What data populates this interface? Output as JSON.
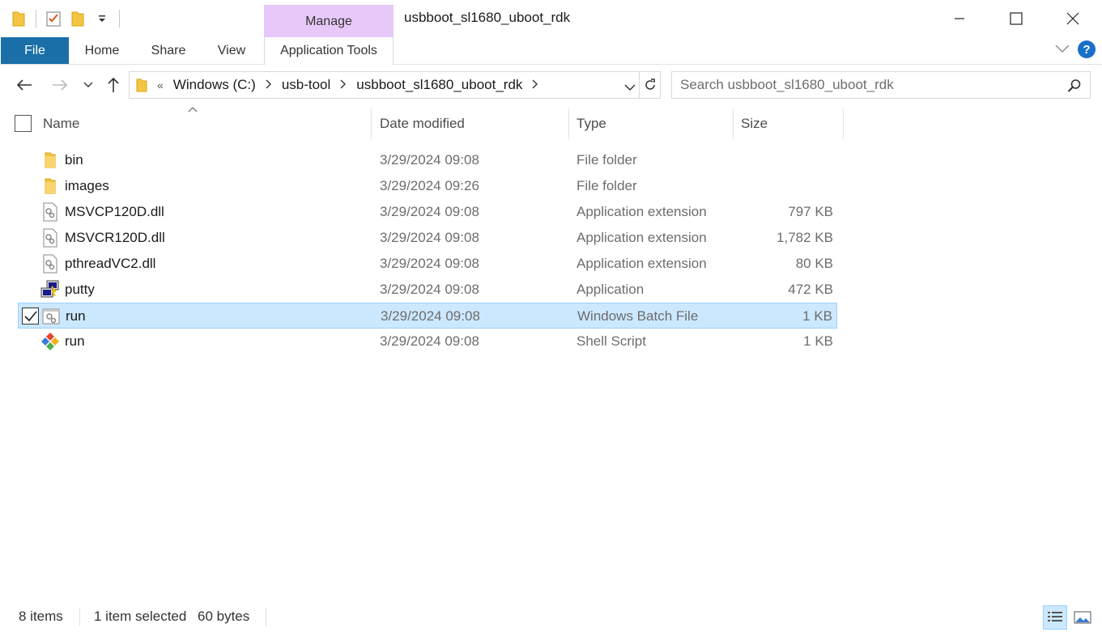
{
  "window": {
    "title": "usbboot_sl1680_uboot_rdk",
    "contextual_group": "Manage"
  },
  "ribbon": {
    "tabs": [
      {
        "label": "File"
      },
      {
        "label": "Home"
      },
      {
        "label": "Share"
      },
      {
        "label": "View"
      },
      {
        "label": "Application Tools"
      }
    ],
    "help_label": "?"
  },
  "address": {
    "overflow": "«",
    "crumbs": [
      "Windows (C:)",
      "usb-tool",
      "usbboot_sl1680_uboot_rdk"
    ]
  },
  "search": {
    "placeholder": "Search usbboot_sl1680_uboot_rdk"
  },
  "columns": {
    "name": "Name",
    "date": "Date modified",
    "type": "Type",
    "size": "Size"
  },
  "files": [
    {
      "name": "bin",
      "date": "3/29/2024 09:08",
      "type": "File folder",
      "size": "",
      "icon": "folder-icon"
    },
    {
      "name": "images",
      "date": "3/29/2024 09:26",
      "type": "File folder",
      "size": "",
      "icon": "folder-icon"
    },
    {
      "name": "MSVCP120D.dll",
      "date": "3/29/2024 09:08",
      "type": "Application extension",
      "size": "797 KB",
      "icon": "dll-file-icon"
    },
    {
      "name": "MSVCR120D.dll",
      "date": "3/29/2024 09:08",
      "type": "Application extension",
      "size": "1,782 KB",
      "icon": "dll-file-icon"
    },
    {
      "name": "pthreadVC2.dll",
      "date": "3/29/2024 09:08",
      "type": "Application extension",
      "size": "80 KB",
      "icon": "dll-file-icon"
    },
    {
      "name": "putty",
      "date": "3/29/2024 09:08",
      "type": "Application",
      "size": "472 KB",
      "icon": "putty-icon"
    },
    {
      "name": "run",
      "date": "3/29/2024 09:08",
      "type": "Windows Batch File",
      "size": "1 KB",
      "icon": "batch-file-icon",
      "selected": true
    },
    {
      "name": "run",
      "date": "3/29/2024 09:08",
      "type": "Shell Script",
      "size": "1 KB",
      "icon": "shell-script-icon"
    }
  ],
  "status": {
    "item_count": "8 items",
    "selection": "1 item selected",
    "selection_size": "60 bytes"
  },
  "colors": {
    "file_tab": "#1a6fa8",
    "manage_tab": "#e8c8f8",
    "selection_bg": "#cce8ff",
    "selection_border": "#99d1ff",
    "help_icon": "#1a6fc8"
  }
}
